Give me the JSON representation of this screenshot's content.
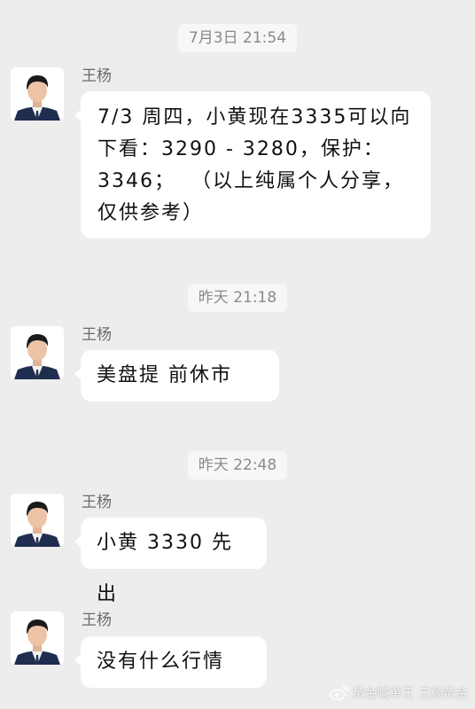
{
  "chat": {
    "sender_name": "王杨",
    "timestamps": [
      "7月3日 21:54",
      "昨天 21:18",
      "昨天 22:48"
    ],
    "messages": [
      {
        "text": "7/3 周四，小黄现在3335可以向下看：3290 - 3280，保护：3346；  （以上纯属个人分享，仅供参考）"
      },
      {
        "text": "美盘提 前休市"
      },
      {
        "text": "小黄 3330 先出"
      },
      {
        "text": "没有什么行情"
      }
    ]
  },
  "watermark": {
    "text": "黄金喊单王 王杨黄金",
    "icon": "weibo-icon"
  }
}
